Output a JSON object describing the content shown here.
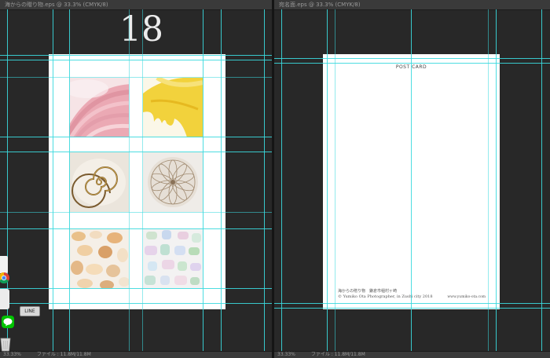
{
  "left_window": {
    "tab_title": "海からの贈り物.eps @ 33.3% (CMYK/8)",
    "page_number": "18",
    "status": {
      "zoom": "33.33%",
      "file_info": "ファイル : 11.8M/11.8M"
    }
  },
  "right_window": {
    "tab_title": "宛名面.eps @ 33.3% (CMYK/8)",
    "status": {
      "zoom": "33.33%",
      "file_info": "ファイル : 11.8M/11.8M"
    },
    "postcard": {
      "title": "POST CARD",
      "caption_line1": "海からの贈り物　鎌倉市稲村ヶ崎",
      "caption_line2": "© Yumiko Ota Photographer, in Zushi city 2018",
      "website": "www.yumiko-ota.com"
    }
  },
  "dock": {
    "tooltip": "LINE",
    "icons": [
      "document-icon",
      "chrome-icon",
      "line-icon",
      "trash-icon"
    ]
  },
  "photos": [
    "pink-shell-photo",
    "yellow-shell-photo",
    "spiral-shell-photo",
    "sea-urchin-photo",
    "amber-sea-glass-photo",
    "pastel-sea-glass-photo"
  ],
  "colors": {
    "guide": "#3ad9de",
    "canvas": "#282828",
    "paper": "#ffffff"
  }
}
